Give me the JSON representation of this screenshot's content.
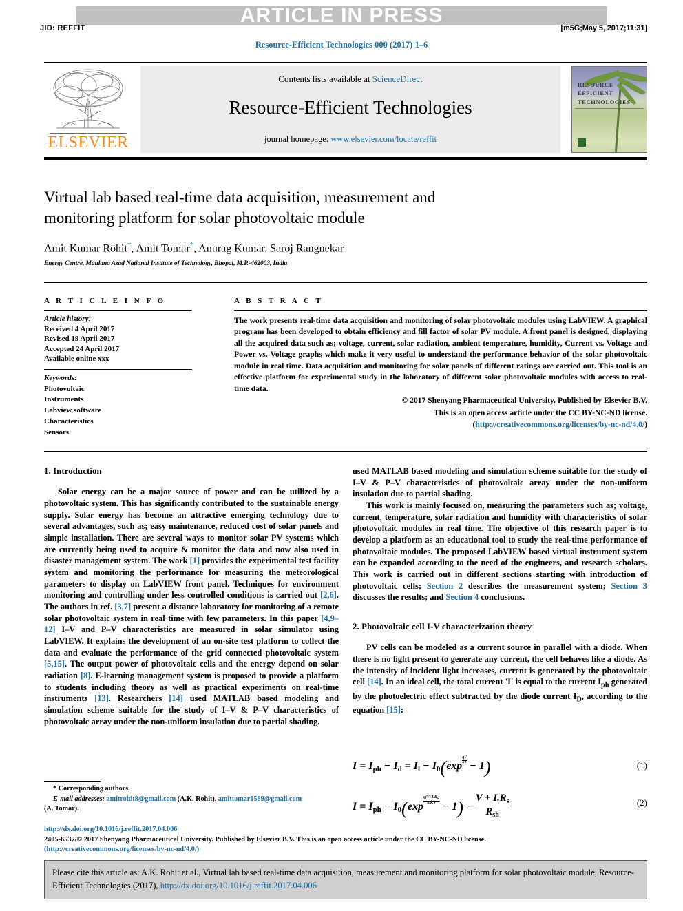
{
  "banner": {
    "article_in_press": "ARTICLE IN PRESS",
    "jid": "JID: REFFIT",
    "stamp": "[m5G;May 5, 2017;11:31]",
    "running_head": "Resource-Efficient Technologies 000 (2017) 1–6"
  },
  "masthead": {
    "contents_prefix": "Contents lists available at ",
    "contents_link": "ScienceDirect",
    "journal_title": "Resource-Efficient Technologies",
    "homepage_prefix": "journal homepage: ",
    "homepage_link": "www.elsevier.com/locate/reffit",
    "publisher_wordmark": "ELSEVIER",
    "publisher_logo_icon": "elsevier-tree-logo",
    "cover_title_line1": "Resource",
    "cover_title_line2": "Efficient",
    "cover_title_line3": "Technologies"
  },
  "article": {
    "title": "Virtual lab based real-time data acquisition, measurement and monitoring platform for solar photovoltaic module",
    "authors": [
      {
        "name": "Amit Kumar Rohit",
        "marker": "*"
      },
      {
        "name": "Amit Tomar",
        "marker": "*"
      },
      {
        "name": "Anurag Kumar",
        "marker": ""
      },
      {
        "name": "Saroj Rangnekar",
        "marker": ""
      }
    ],
    "affiliation": "Energy Centre, Maulana Azad National Institute of Technology, Bhopal, M.P.-462003, India"
  },
  "article_info": {
    "heading": "A R T I C L E   I N F O",
    "history_label": "Article history:",
    "history": [
      "Received 4 April 2017",
      "Revised 19 April 2017",
      "Accepted 24 April 2017",
      "Available online xxx"
    ],
    "keywords_label": "Keywords:",
    "keywords": [
      "Photovoltaic",
      "Instruments",
      "Labview software",
      "Characteristics",
      "Sensors"
    ]
  },
  "abstract": {
    "heading": "A B S T R A C T",
    "body": "The work presents real-time data acquisition and monitoring of solar photovoltaic modules using LabVIEW. A graphical program has been developed to obtain efficiency and fill factor of solar PV module. A front panel is designed, displaying all the acquired data such as; voltage, current, solar radiation, ambient temperature, humidity, Current vs. Voltage and Power vs. Voltage graphs which make it very useful to understand the performance behavior of the solar photovoltaic module in real time. Data acquisition and monitoring for solar panels of different ratings are carried out. This tool is an effective platform for experimental study in the laboratory of different solar photovoltaic modules with access to real-time data.",
    "copyright_line1": "© 2017 Shenyang Pharmaceutical University. Published by Elsevier B.V.",
    "copyright_line2": "This is an open access article under the CC BY-NC-ND license.",
    "license_url": "http://creativecommons.org/licenses/by-nc-nd/4.0/"
  },
  "sections": {
    "intro_heading": "1.  Introduction",
    "intro_p1_a": "Solar energy can be a major source of power and can be utilized by a photovoltaic system. This has significantly contributed to the sustainable energy supply. Solar energy has become an attractive emerging technology due to several advantages, such as; easy maintenance, reduced cost of solar panels and simple installation. There are several ways to monitor solar PV systems which are currently being used to acquire & monitor the data and now also used in disaster management system. The work ",
    "ref1": "[1]",
    "intro_p1_b": " provides the experimental test facility system and monitoring the performance for measuring the meteorological parameters to display on LabVIEW front panel. Techniques for environment monitoring and controlling under less controlled conditions is carried out ",
    "ref26": "[2,6]",
    "intro_p1_c": ". The authors in ref. ",
    "ref37": "[3,7]",
    "intro_p1_d": " present a distance laboratory for monitoring of a remote solar photovoltaic system in real time with few parameters. In this paper ",
    "ref4912": "[4,9–12]",
    "intro_p1_e": " I–V and P–V characteristics are measured in solar simulator using LabVIEW. It explains the development of an on-site test platform to collect the data and evaluate the performance of the grid connected photovoltaic system ",
    "ref515": "[5,15]",
    "intro_p1_f": ". The output power of photovoltaic cells and the energy depend on solar radiation ",
    "ref8": "[8]",
    "intro_p1_g": ". E-learning management system is proposed to provide a platform to students including theory as well as practical experiments on real-time instruments ",
    "ref13": "[13]",
    "intro_p1_h": ". Researchers ",
    "ref14": "[14]",
    "intro_p1_i": " used MATLAB based modeling and simulation scheme suitable for the study of I–V & P–V characteristics of photovoltaic array under the non-uniform insulation due to partial shading.",
    "intro_p2_a": "This work is mainly focused on, measuring the parameters such as; voltage, current, temperature, solar radiation and humidity with characteristics of solar photovoltaic modules in real time. The objective of this research paper is to develop a platform as an educational tool to study the real-time performance of photovoltaic modules. The proposed LabVIEW based virtual instrument system can be expanded according to the need of the engineers, and research scholars. This work is carried out in different sections starting with introduction of photovoltaic cells; ",
    "sec2_link": "Section 2",
    "intro_p2_b": " describes the measurement system; ",
    "sec3_link": "Section 3",
    "intro_p2_c": " discusses the results; and ",
    "sec4_link": "Section 4",
    "intro_p2_d": " conclusions.",
    "theory_heading": "2.  Photovoltaic cell I-V characterization theory",
    "theory_p1_a": "PV cells can be modeled as a current source in parallel with a diode. When there is no light present to generate any current, the cell behaves like a diode. As the intensity of incident light increases, current is generated by the photovoltaic cell ",
    "theory_ref14": "[14]",
    "theory_p1_b": ". In an ideal cell, the total current 'I' is equal to the current I",
    "theory_sub_ph": "ph",
    "theory_p1_c": " generated by the photoelectric effect subtracted by the diode current I",
    "theory_sub_d": "D",
    "theory_p1_d": ", according to the equation ",
    "theory_ref15": "[15]",
    "theory_p1_e": ":"
  },
  "equations": {
    "eq1_number": "(1)",
    "eq2_number": "(2)",
    "eq1_text": "I = I_ph − I_d = I_l − I_0( exp^(qV/kT) − 1 )",
    "eq2_text": "I = I_ph − I_0( exp^(q(V+I.Rs)/n.k.T) − 1 ) − (V + I.Rs)/R_sh"
  },
  "footnote": {
    "star": "*",
    "corresponding": "Corresponding authors.",
    "email_label": "E-mail addresses:",
    "email1": "amitrohit8@gmail.com",
    "email1_owner": "(A.K. Rohit),",
    "email2": "amittomar1589@gmail.com",
    "email2_owner": "(A. Tomar)."
  },
  "footer": {
    "doi": "http://dx.doi.org/10.1016/j.reffit.2017.04.006",
    "issn_line": "2405-6537/© 2017 Shenyang Pharmaceutical University. Published by Elsevier B.V. This is an open access article under the CC BY-NC-ND license.",
    "license_url": "(http://creativecommons.org/licenses/by-nc-nd/4.0/)"
  },
  "cite_box": {
    "text_a": "Please cite this article as: A.K. Rohit et al., Virtual lab based real-time data acquisition, measurement and monitoring platform for solar photovoltaic module, Resource-Efficient Technologies (2017), ",
    "link": "http://dx.doi.org/10.1016/j.reffit.2017.04.006"
  },
  "colors": {
    "link_blue": "#1d6fa5",
    "elsevier_orange": "#ec8b22",
    "banner_gray": "#c0c0c0",
    "mast_gray": "#ececec",
    "cite_box_gray": "#cfcfcf"
  }
}
